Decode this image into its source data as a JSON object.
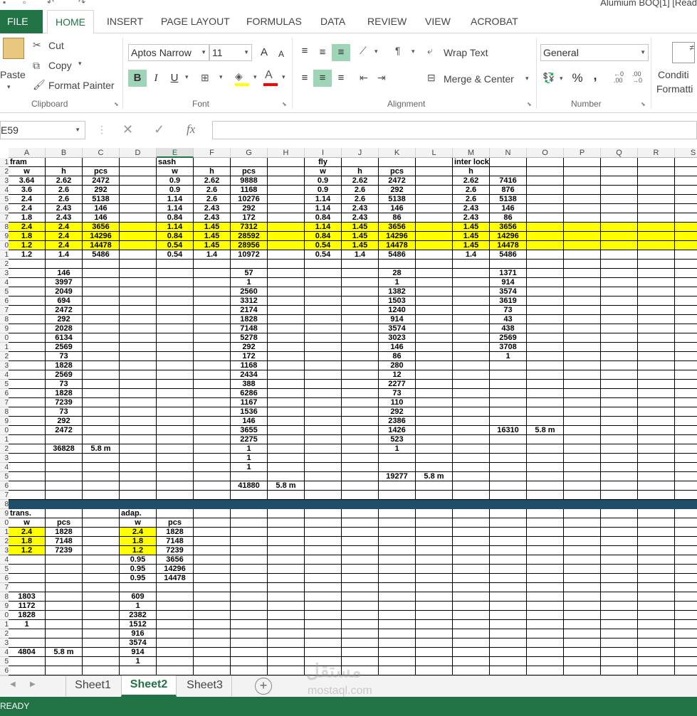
{
  "window_title": "Alumium BOQ[1]  [Read",
  "tabs": [
    "FILE",
    "HOME",
    "INSERT",
    "PAGE LAYOUT",
    "FORMULAS",
    "DATA",
    "REVIEW",
    "VIEW",
    "ACROBAT"
  ],
  "ribbon": {
    "clipboard": {
      "paste": "Paste",
      "cut": "Cut",
      "copy": "Copy",
      "format_painter": "Format Painter",
      "label": "Clipboard"
    },
    "font": {
      "name": "Aptos Narrow",
      "size": "11",
      "bold": "B",
      "italic": "I",
      "underline": "U",
      "grow": "A",
      "shrink": "A",
      "label": "Font"
    },
    "alignment": {
      "wrap_text": "Wrap Text",
      "merge_center": "Merge & Center",
      "label": "Alignment"
    },
    "number": {
      "format": "General",
      "percent": "%",
      "comma": ",",
      "inc_decimal": "←0 .00",
      "dec_decimal": ".00 →0",
      "label": "Number"
    },
    "styles": {
      "conditional_1": "Conditi",
      "conditional_2": "Formatti"
    }
  },
  "formula_bar": {
    "name_box": "E59",
    "fx": "fx",
    "value": ""
  },
  "grid": {
    "columns": [
      "A",
      "B",
      "C",
      "D",
      "E",
      "F",
      "G",
      "H",
      "I",
      "J",
      "K",
      "L",
      "M",
      "N",
      "O",
      "P",
      "Q",
      "R",
      "S"
    ],
    "active_column": "E",
    "first_row": 1,
    "row_count": 57,
    "highlight_color": "#ffff00",
    "separator_color": "#1f4e6b",
    "separator_row": 38,
    "highlight_cells": [
      "A8",
      "B8",
      "C8",
      "E8",
      "F8",
      "G8",
      "I8",
      "J8",
      "K8",
      "M8",
      "N8",
      "A9",
      "B9",
      "C9",
      "E9",
      "F9",
      "G9",
      "I9",
      "J9",
      "K9",
      "M9",
      "N9",
      "A10",
      "B10",
      "C10",
      "E10",
      "F10",
      "G10",
      "I10",
      "J10",
      "K10",
      "M10",
      "N10",
      "A41",
      "A42",
      "A43",
      "D41",
      "D42",
      "D43"
    ],
    "fullrow_highlight": [
      8,
      9,
      10
    ],
    "cells": {
      "A1": "fram",
      "E1": "sash",
      "I1": "fly",
      "M1": "inter lock",
      "A2": "w",
      "B2": "h",
      "C2": "pcs",
      "E2": "w",
      "F2": "h",
      "G2": "pcs",
      "I2": "w",
      "J2": "h",
      "K2": "pcs",
      "M2": "h",
      "A3": "3.64",
      "B3": "2.62",
      "C3": "2472",
      "E3": "0.9",
      "F3": "2.62",
      "G3": "9888",
      "I3": "0.9",
      "J3": "2.62",
      "K3": "2472",
      "M3": "2.62",
      "N3": "7416",
      "A4": "3.6",
      "B4": "2.6",
      "C4": "292",
      "E4": "0.9",
      "F4": "2.6",
      "G4": "1168",
      "I4": "0.9",
      "J4": "2.6",
      "K4": "292",
      "M4": "2.6",
      "N4": "876",
      "A5": "2.4",
      "B5": "2.6",
      "C5": "5138",
      "E5": "1.14",
      "F5": "2.6",
      "G5": "10276",
      "I5": "1.14",
      "J5": "2.6",
      "K5": "5138",
      "M5": "2.6",
      "N5": "5138",
      "A6": "2.4",
      "B6": "2.43",
      "C6": "146",
      "E6": "1.14",
      "F6": "2.43",
      "G6": "292",
      "I6": "1.14",
      "J6": "2.43",
      "K6": "146",
      "M6": "2.43",
      "N6": "146",
      "A7": "1.8",
      "B7": "2.43",
      "C7": "146",
      "E7": "0.84",
      "F7": "2.43",
      "G7": "172",
      "I7": "0.84",
      "J7": "2.43",
      "K7": "86",
      "M7": "2.43",
      "N7": "86",
      "A8": "2.4",
      "B8": "2.4",
      "C8": "3656",
      "E8": "1.14",
      "F8": "1.45",
      "G8": "7312",
      "I8": "1.14",
      "J8": "1.45",
      "K8": "3656",
      "M8": "1.45",
      "N8": "3656",
      "A9": "1.8",
      "B9": "2.4",
      "C9": "14296",
      "E9": "0.84",
      "F9": "1.45",
      "G9": "28592",
      "I9": "0.84",
      "J9": "1.45",
      "K9": "14296",
      "M9": "1.45",
      "N9": "14296",
      "A10": "1.2",
      "B10": "2.4",
      "C10": "14478",
      "E10": "0.54",
      "F10": "1.45",
      "G10": "28956",
      "I10": "0.54",
      "J10": "1.45",
      "K10": "14478",
      "M10": "1.45",
      "N10": "14478",
      "A11": "1.2",
      "B11": "1.4",
      "C11": "5486",
      "E11": "0.54",
      "F11": "1.4",
      "G11": "10972",
      "I11": "0.54",
      "J11": "1.4",
      "K11": "5486",
      "M11": "1.4",
      "N11": "5486",
      "B13": "146",
      "G13": "57",
      "K13": "28",
      "N13": "1371",
      "B14": "3997",
      "G14": "1",
      "K14": "1",
      "N14": "914",
      "B15": "2049",
      "G15": "2560",
      "K15": "1382",
      "N15": "3574",
      "B16": "694",
      "G16": "3312",
      "K16": "1503",
      "N16": "3619",
      "B17": "2472",
      "G17": "2174",
      "K17": "1240",
      "N17": "73",
      "B18": "292",
      "G18": "1828",
      "K18": "914",
      "N18": "43",
      "B19": "2028",
      "G19": "7148",
      "K19": "3574",
      "N19": "438",
      "B20": "6134",
      "G20": "5278",
      "K20": "3023",
      "N20": "2569",
      "B21": "2569",
      "G21": "292",
      "K21": "146",
      "N21": "3708",
      "B22": "73",
      "G22": "172",
      "K22": "86",
      "N22": "1",
      "B23": "1828",
      "G23": "1168",
      "K23": "280",
      "B24": "2569",
      "G24": "2434",
      "K24": "12",
      "B25": "73",
      "G25": "388",
      "K25": "2277",
      "B26": "1828",
      "G26": "6286",
      "K26": "73",
      "B27": "7239",
      "G27": "1167",
      "K27": "110",
      "B28": "73",
      "G28": "1536",
      "K28": "292",
      "B29": "292",
      "G29": "146",
      "K29": "2386",
      "B30": "2472",
      "G30": "3655",
      "K30": "1426",
      "N30": "16310",
      "O30": "5.8 m",
      "G31": "2275",
      "K31": "523",
      "B32": "36828",
      "C32": "5.8 m",
      "G32": "1",
      "K32": "1",
      "G33": "1",
      "G34": "1",
      "K35": "19277",
      "L35": "5.8 m",
      "G36": "41880",
      "H36": "5.8 m",
      "A39": "trans.",
      "D39": "adap.",
      "A40": "w",
      "B40": "pcs",
      "D40": "w",
      "E40": "pcs",
      "A41": "2.4",
      "B41": "1828",
      "D41": "2.4",
      "E41": "1828",
      "A42": "1.8",
      "B42": "7148",
      "D42": "1.8",
      "E42": "7148",
      "A43": "1.2",
      "B43": "7239",
      "D43": "1.2",
      "E43": "7239",
      "D44": "0.95",
      "E44": "3656",
      "D45": "0.95",
      "E45": "14296",
      "D46": "0.95",
      "E46": "14478",
      "A48": "1803",
      "D48": "609",
      "A49": "1172",
      "D49": "1",
      "A50": "1828",
      "D50": "2382",
      "A51": "1",
      "D51": "1512",
      "D52": "916",
      "D53": "3574",
      "A54": "4804",
      "B54": "5.8 m",
      "D54": "914",
      "D55": "1"
    }
  },
  "sheets": {
    "tabs": [
      "Sheet1",
      "Sheet2",
      "Sheet3"
    ],
    "active": "Sheet2",
    "add": "+"
  },
  "status": {
    "text": "READY"
  },
  "watermark": {
    "text": "مستقل",
    "sub": "mostaql.com"
  }
}
